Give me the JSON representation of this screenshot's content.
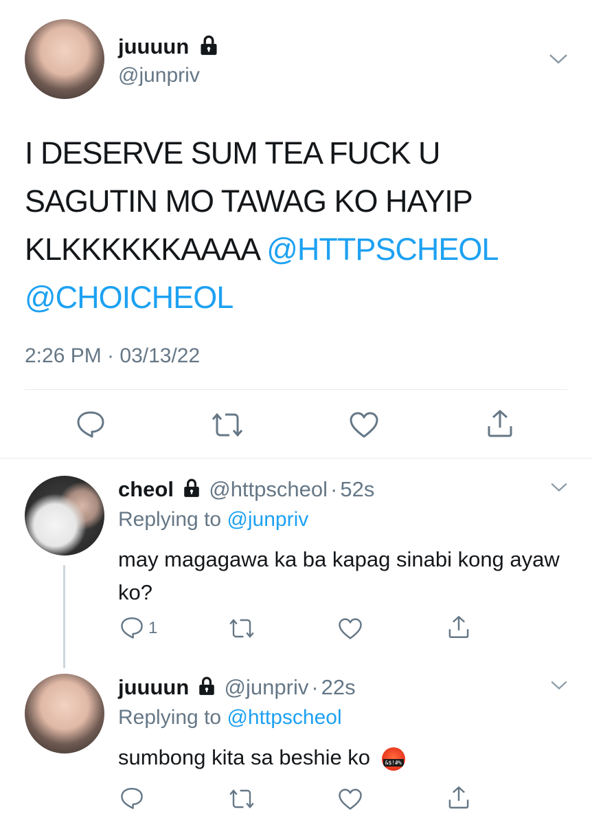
{
  "main_tweet": {
    "display_name": "juuuun",
    "handle": "@junpriv",
    "text_plain": "I DESERVE SUM TEA FUCK U SAGUTIN MO TAWAG KO HAYIP KLKKKKKKAAAA",
    "line1": "I DESERVE SUM TEA FUCK U",
    "line2": "SAGUTIN MO TAWAG KO HAYIP",
    "line3_prefix": "KLKKKKKKAAAA",
    "mention1": "@HTTPSCHEOL",
    "mention2": "@CHOICHEOL",
    "timestamp": "2:26 PM · 03/13/22"
  },
  "replies": [
    {
      "display_name": "cheol",
      "handle": "@httpscheol",
      "time": "52s",
      "replying_prefix": "Replying to",
      "replying_to": "@junpriv",
      "text": "may magagawa ka ba kapag sinabi kong ayaw ko?",
      "reply_count": "1"
    },
    {
      "display_name": "juuuun",
      "handle": "@junpriv",
      "time": "22s",
      "replying_prefix": "Replying to",
      "replying_to": "@httpscheol",
      "text": "sumbong kita sa beshie ko",
      "emoji_text": "&$!#%",
      "reply_count": ""
    }
  ],
  "separator": "·",
  "icons": [
    "lock-icon",
    "chevron-down-icon",
    "reply-icon",
    "retweet-icon",
    "like-icon",
    "share-icon",
    "angry-face-emoji"
  ],
  "colors": {
    "link": "#1da1f2",
    "muted": "#657786",
    "text": "#14171a",
    "divider": "#e6ecf0"
  }
}
